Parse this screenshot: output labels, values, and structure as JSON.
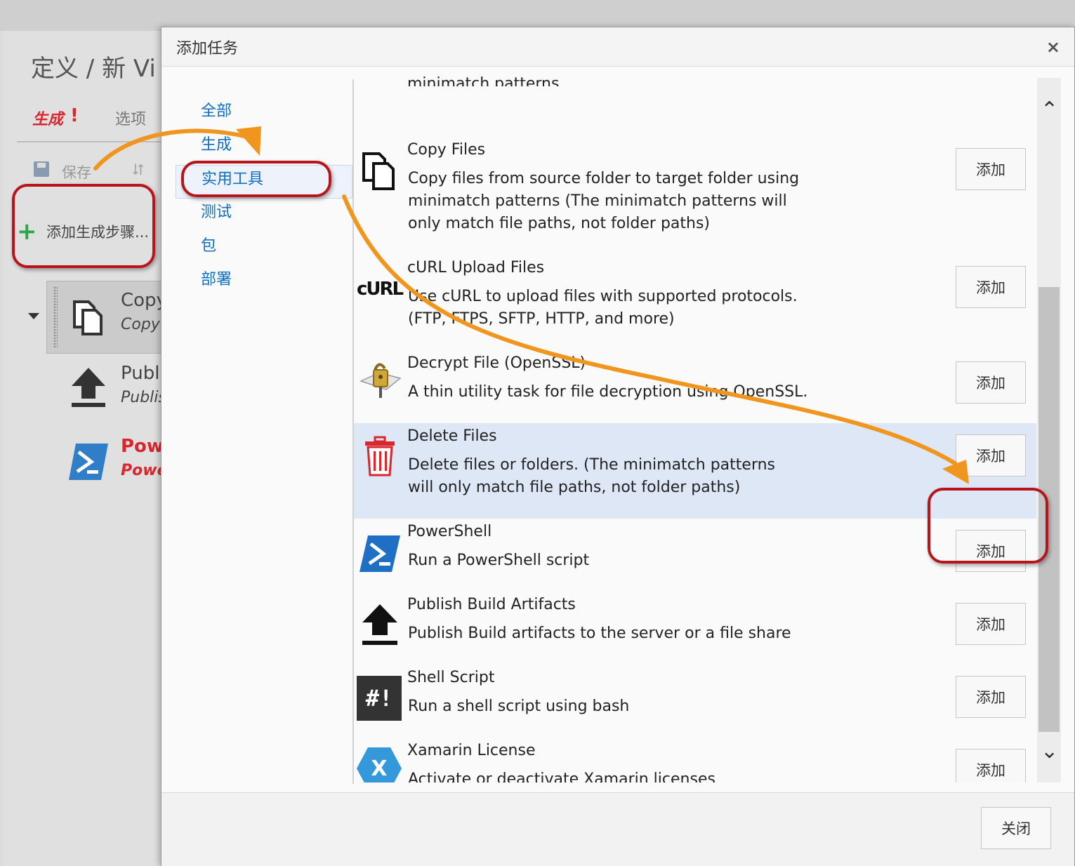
{
  "background": {
    "title": "定义 / 新 Vi",
    "tabs": [
      {
        "label": "生成",
        "alert": "!"
      },
      {
        "label": "选项"
      }
    ],
    "toolbar": {
      "save_label": "保存"
    },
    "add_step_label": "添加生成步骤...",
    "steps": [
      {
        "name": "Copy",
        "sub": "Copy",
        "icon": "copy-files-icon"
      },
      {
        "name": "Publi",
        "sub": "Publis",
        "icon": "upload-arrow-icon"
      },
      {
        "name": "Pow",
        "sub": "Powe",
        "icon": "powershell-icon"
      }
    ],
    "colors": {
      "error_red": "#d9272e",
      "add_green": "#2ea44f"
    }
  },
  "dialog": {
    "title": "添加任务",
    "close_glyph": "×",
    "categories": [
      {
        "label": "全部"
      },
      {
        "label": "生成"
      },
      {
        "label": "实用工具",
        "active": true
      },
      {
        "label": "测试"
      },
      {
        "label": "包"
      },
      {
        "label": "部署"
      }
    ],
    "cut_off_text": "minimatch patterns",
    "add_label": "添加",
    "tasks": [
      {
        "name": "Copy Files",
        "description": "Copy files from source folder to target folder using minimatch patterns (The minimatch patterns will only match file paths, not folder paths)",
        "icon": "copy-files-icon"
      },
      {
        "name": "cURL Upload Files",
        "description": "Use cURL to upload files with supported protocols. (FTP, FTPS, SFTP, HTTP, and more)",
        "icon": "curl-icon",
        "icon_text": "cURL"
      },
      {
        "name": "Decrypt File (OpenSSL)",
        "description": "A thin utility task for file decryption using OpenSSL.",
        "icon": "decrypt-lock-icon"
      },
      {
        "name": "Delete Files",
        "description": "Delete files or folders. (The minimatch patterns will only match file paths, not folder paths)",
        "icon": "trash-icon",
        "selected": true
      },
      {
        "name": "PowerShell",
        "description": "Run a PowerShell script",
        "icon": "powershell-icon"
      },
      {
        "name": "Publish Build Artifacts",
        "description": "Publish Build artifacts to the server or a file share",
        "icon": "upload-arrow-icon"
      },
      {
        "name": "Shell Script",
        "description": "Run a shell script using bash",
        "icon": "shell-script-icon",
        "icon_text": "#!"
      },
      {
        "name": "Xamarin License",
        "description": "Activate or deactivate Xamarin licenses",
        "icon": "xamarin-icon",
        "icon_text": "X"
      }
    ],
    "footer": {
      "close_label": "关闭"
    }
  },
  "annotations": {
    "callout_color": "#b8141c",
    "arrow_color": "#f0961e"
  }
}
